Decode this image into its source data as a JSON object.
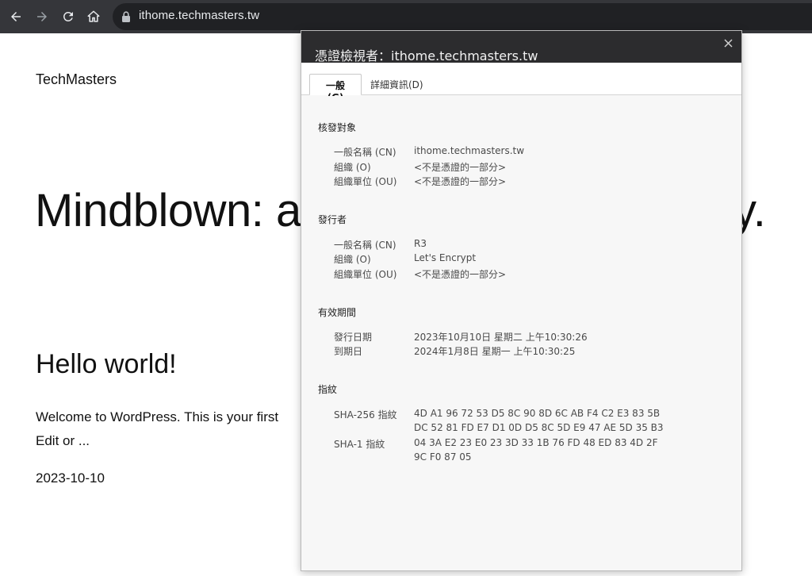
{
  "browser": {
    "url": "ithome.techmasters.tw"
  },
  "page": {
    "site_title": "TechMasters",
    "headline": "Mindblown: a",
    "headline_end": "y.",
    "post_title": "Hello world!",
    "post_excerpt_line1": "Welcome to WordPress. This is your first",
    "post_excerpt_line2": "Edit or ...",
    "post_date": "2023-10-10"
  },
  "cert": {
    "title": "憑證檢視者：ithome.techmasters.tw",
    "tabs": [
      {
        "label": "一般(G)",
        "active": true
      },
      {
        "label": "詳細資訊(D)",
        "active": false
      }
    ],
    "issued_to": {
      "heading": "核發對象",
      "rows": [
        {
          "label": "一般名稱 (CN)",
          "value": "ithome.techmasters.tw"
        },
        {
          "label": "組織 (O)",
          "value": "<不是憑證的一部分>"
        },
        {
          "label": "組織單位 (OU)",
          "value": "<不是憑證的一部分>"
        }
      ]
    },
    "issuer": {
      "heading": "發行者",
      "rows": [
        {
          "label": "一般名稱 (CN)",
          "value": "R3"
        },
        {
          "label": "組織 (O)",
          "value": "Let's Encrypt"
        },
        {
          "label": "組織單位 (OU)",
          "value": "<不是憑證的一部分>"
        }
      ]
    },
    "validity": {
      "heading": "有效期間",
      "rows": [
        {
          "label": "發行日期",
          "value": "2023年10月10日 星期二 上午10:30:26"
        },
        {
          "label": "到期日",
          "value": "2024年1月8日 星期一 上午10:30:25"
        }
      ]
    },
    "fingerprints": {
      "heading": "指紋",
      "sha256_label": "SHA-256 指紋",
      "sha256_line1": "4D A1 96 72 53 D5 8C 90 8D 6C AB F4 C2 E3 83 5B",
      "sha256_line2": "DC 52 81 FD E7 D1 0D D5 8C 5D E9 47 AE 5D 35 B3",
      "sha1_label": "SHA-1 指紋",
      "sha1_line1": "04 3A E2 23 E0 23 3D 33 1B 76 FD 48 ED 83 4D 2F",
      "sha1_line2": "9C F0 87 05"
    }
  },
  "colors": {
    "toolbar": "#35363a",
    "omnibox": "#202124",
    "dialog_header": "#2c2c2e"
  }
}
